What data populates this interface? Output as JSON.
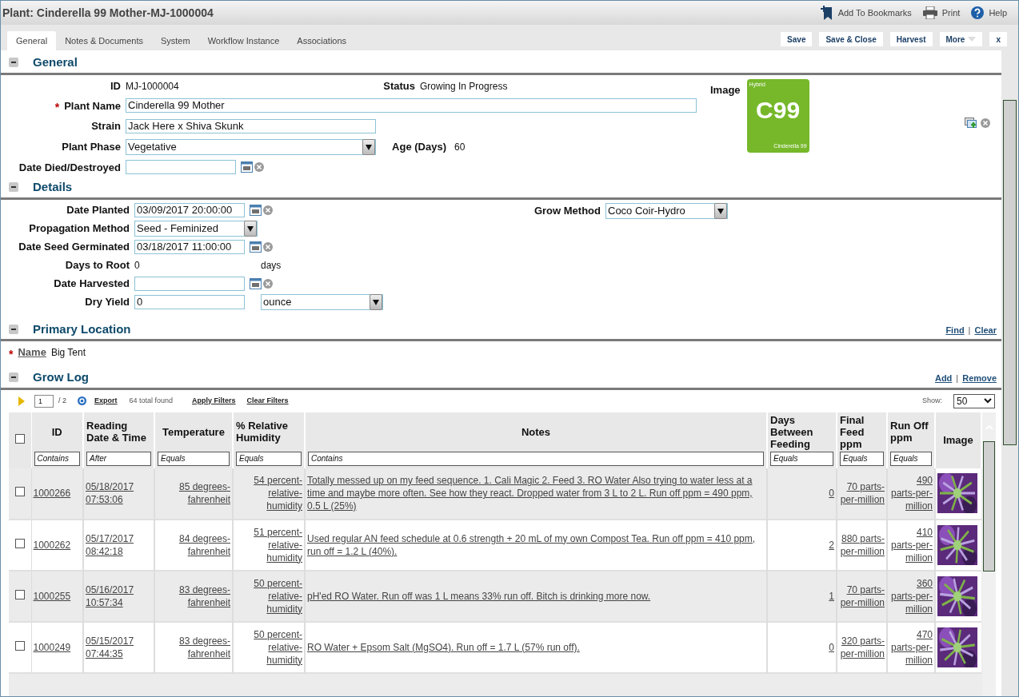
{
  "window": {
    "title": "Plant: Cinderella 99 Mother-MJ-1000004"
  },
  "header_links": [
    {
      "kind": "bookmark",
      "label": "Add To Bookmarks"
    },
    {
      "kind": "print",
      "label": "Print"
    },
    {
      "kind": "help",
      "label": "Help"
    }
  ],
  "tabs": [
    {
      "label": "General",
      "selected": true
    },
    {
      "label": "Notes & Documents",
      "selected": false
    },
    {
      "label": "System",
      "selected": false
    },
    {
      "label": "Workflow Instance",
      "selected": false
    },
    {
      "label": "Associations",
      "selected": false
    }
  ],
  "action_buttons": [
    {
      "label": "Save",
      "kind": "plain"
    },
    {
      "label": "Save & Close",
      "kind": "plain"
    },
    {
      "label": "Harvest",
      "kind": "plain"
    },
    {
      "label": "More",
      "kind": "menu"
    },
    {
      "label": "x",
      "kind": "plain"
    }
  ],
  "general": {
    "heading": "General",
    "id": {
      "label": "ID",
      "value": "MJ-1000004"
    },
    "status": {
      "label": "Status",
      "value": "Growing In Progress"
    },
    "plant_name": {
      "label": "Plant Name",
      "value": "Cinderella 99 Mother",
      "required": true
    },
    "strain": {
      "label": "Strain",
      "value": "Jack Here x Shiva Skunk"
    },
    "plant_phase": {
      "label": "Plant Phase",
      "value": "Vegetative"
    },
    "age": {
      "label": "Age (Days)",
      "value": "60"
    },
    "date_died": {
      "label": "Date Died/Destroyed"
    },
    "image": {
      "label": "Image",
      "category": "Hybrid",
      "code": "C99",
      "name": "Cinderella 99"
    }
  },
  "details": {
    "heading": "Details",
    "fields": [
      {
        "kind": "date",
        "label": "Date Planted",
        "value": "03/09/2017 20:00:00"
      },
      {
        "kind": "select",
        "label": "Propagation Method",
        "value": "Seed - Feminized"
      },
      {
        "kind": "date",
        "label": "Date Seed Germinated",
        "value": "03/18/2017 11:00:00"
      },
      {
        "kind": "readonly",
        "label": "Days to Root",
        "value": "0",
        "unit": "days"
      },
      {
        "kind": "date",
        "label": "Date Harvested"
      },
      {
        "kind": "yield",
        "label": "Dry Yield",
        "value": "0",
        "unit": "ounce"
      }
    ],
    "grow_method": {
      "label": "Grow Method",
      "value": "Coco Coir-Hydro"
    }
  },
  "required_mark": "*",
  "primary_location": {
    "heading": "Primary Location",
    "links": [
      "Find",
      "Clear"
    ],
    "separator": "|",
    "name": {
      "label": "Name",
      "value": "Big Tent",
      "required": true
    }
  },
  "grow_log": {
    "heading": "Grow Log",
    "links": [
      "Add",
      "Remove"
    ],
    "separator": "|",
    "all_checked": false,
    "toolbar": {
      "page": "1",
      "pages": "/ 2",
      "export": "Export",
      "total": "64 total found",
      "apply": "Apply Filters",
      "clear": "Clear Filters",
      "show_label": "Show:",
      "show_value": "50"
    },
    "columns": [
      {
        "label": "ID",
        "filter": "Contains"
      },
      {
        "label": "Reading Date & Time",
        "filter": "After"
      },
      {
        "label": "Temperature",
        "filter": "Equals"
      },
      {
        "label": "% Relative Humidity",
        "filter": "Equals"
      },
      {
        "label": "Notes",
        "filter": "Contains"
      },
      {
        "label": "Days Between Feeding",
        "filter": "Equals"
      },
      {
        "label": "Final Feed ppm",
        "filter": "Equals"
      },
      {
        "label": "Run Off ppm",
        "filter": "Equals"
      },
      {
        "label": "Image"
      }
    ],
    "rows": [
      {
        "checked": false,
        "cells": [
          "1000266",
          "05/18/2017 07:53:06",
          "85 degrees-fahrenheit",
          "54 percent-relative-humidity",
          "Totally messed up on my feed sequence. 1. Cali Magic 2. Feed 3. RO Water Also trying to water less at a time and maybe more often. See how they react. Dropped water from 3 L to 2 L. Run off ppm = 490 ppm, 0.5 L (25%)",
          "0",
          "70 parts-per-million",
          "490 parts-per-million"
        ]
      },
      {
        "checked": false,
        "cells": [
          "1000262",
          "05/17/2017 08:42:18",
          "84 degrees-fahrenheit",
          "51 percent-relative-humidity",
          "Used regular AN feed schedule at 0.6 strength + 20 mL of my own Compost Tea. Run off ppm = 410 ppm, run off = 1.2 L (40%).",
          "2",
          "880 parts-per-million",
          "410 parts-per-million"
        ]
      },
      {
        "checked": false,
        "cells": [
          "1000255",
          "05/16/2017 10:57:34",
          "83 degrees-fahrenheit",
          "50 percent-relative-humidity",
          "pH'ed RO Water. Run off was 1 L means 33% run off. Bitch is drinking more now.",
          "1",
          "70 parts-per-million",
          "360 parts-per-million"
        ]
      },
      {
        "checked": false,
        "cells": [
          "1000249",
          "05/15/2017 07:44:35",
          "83 degrees-fahrenheit",
          "50 percent-relative-humidity",
          "RO Water + Epsom Salt (MgSO4). Run off = 1.7 L (57% run off).",
          "0",
          "320 parts-per-million",
          "470 parts-per-million"
        ]
      }
    ]
  }
}
